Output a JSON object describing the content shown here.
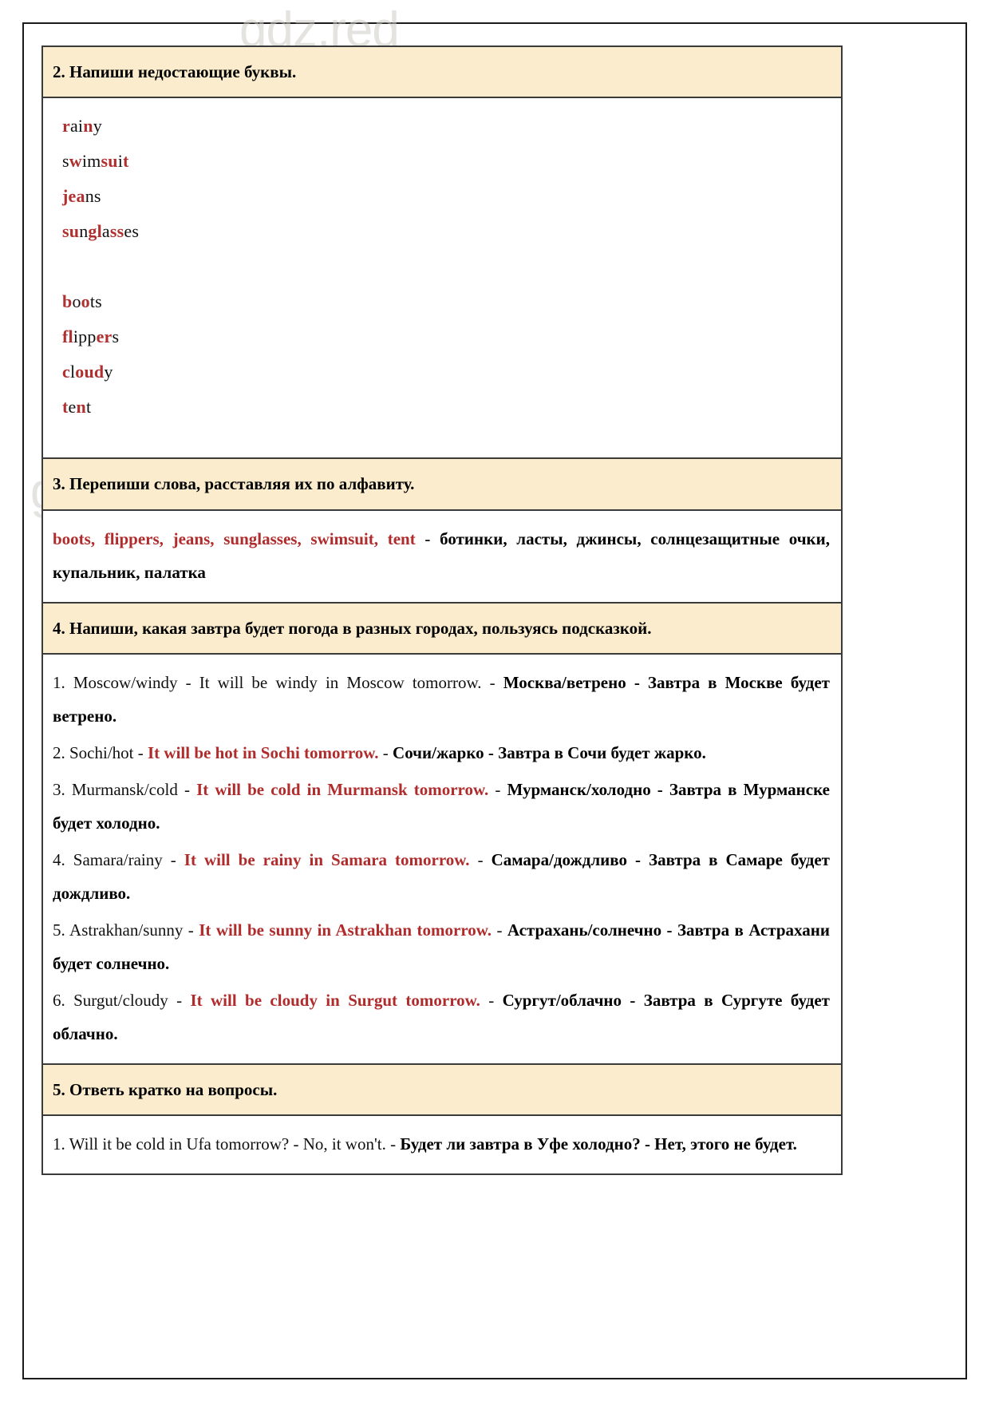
{
  "watermark": {
    "text": "gdz.red"
  },
  "tasks": [
    {
      "id": "task-2",
      "heading": "2. Напиши недостающие буквы.",
      "words": [
        {
          "word": "rainy",
          "parts": [
            [
              "r",
              "red"
            ],
            [
              "ai",
              "black"
            ],
            [
              "n",
              "red"
            ],
            [
              "y",
              "black"
            ]
          ]
        },
        {
          "word": "swimsuit",
          "parts": [
            [
              "s",
              "black"
            ],
            [
              "w",
              "red"
            ],
            [
              "im",
              "black"
            ],
            [
              "su",
              "red"
            ],
            [
              "i",
              "black"
            ],
            [
              "t",
              "red"
            ]
          ]
        },
        {
          "word": "jeans",
          "parts": [
            [
              "je",
              "red"
            ],
            [
              "a",
              "red"
            ],
            [
              "ns",
              "black"
            ]
          ]
        },
        {
          "word": "sunglasses",
          "parts": [
            [
              "su",
              "red"
            ],
            [
              "n",
              "black"
            ],
            [
              "gl",
              "red"
            ],
            [
              "a",
              "black"
            ],
            [
              "ss",
              "red"
            ],
            [
              "es",
              "black"
            ]
          ]
        },
        {
          "word": "",
          "parts": []
        },
        {
          "word": "boots",
          "parts": [
            [
              "b",
              "red"
            ],
            [
              "o",
              "black"
            ],
            [
              "o",
              "red"
            ],
            [
              "ts",
              "black"
            ]
          ]
        },
        {
          "word": "flippers",
          "parts": [
            [
              "fl",
              "red"
            ],
            [
              "ipp",
              "black"
            ],
            [
              "er",
              "red"
            ],
            [
              "s",
              "black"
            ]
          ]
        },
        {
          "word": "cloudy",
          "parts": [
            [
              "c",
              "red"
            ],
            [
              "l",
              "black"
            ],
            [
              "ou",
              "red"
            ],
            [
              "d",
              "red"
            ],
            [
              "y",
              "black"
            ]
          ]
        },
        {
          "word": "tent",
          "parts": [
            [
              "t",
              "red"
            ],
            [
              "e",
              "black"
            ],
            [
              "n",
              "red"
            ],
            [
              "t",
              "black"
            ]
          ]
        }
      ]
    },
    {
      "id": "task-3",
      "heading": "3. Перепиши слова, расставляя их по алфавиту.",
      "answer_en": "boots, flippers, jeans, sunglasses, swimsuit, tent",
      "answer_sep": " - ",
      "answer_ru": "ботинки, ласты, джинсы, солнцезащитные очки, купальник, палатка"
    },
    {
      "id": "task-4",
      "heading": "4. Напиши, какая завтра будет погода в разных городах, пользуясь подсказкой.",
      "items": [
        {
          "num": "1.",
          "prompt": "Moscow/windy",
          "answer_en": "It will be windy in Moscow tomorrow.",
          "answer_en_color": "black",
          "answer_ru": "Москва/ветрено - Завтра в Москве будет ветрено."
        },
        {
          "num": "2.",
          "prompt": "Sochi/hot",
          "answer_en": "It will be hot in Sochi tomorrow.",
          "answer_en_color": "red",
          "answer_ru": "Сочи/жарко - Завтра в Сочи будет жарко."
        },
        {
          "num": "3.",
          "prompt": "Murmansk/cold",
          "answer_en": "It will be cold in Murmansk tomorrow.",
          "answer_en_color": "red",
          "answer_ru": "Мурманск/холодно - Завтра в Мурманске будет холодно."
        },
        {
          "num": "4.",
          "prompt": "Samara/rainy",
          "answer_en": "It will be rainy in Samara tomorrow.",
          "answer_en_color": "red",
          "answer_ru": "Самара/дождливо - Завтра в Самаре будет дождливо."
        },
        {
          "num": "5.",
          "prompt": "Astrakhan/sunny",
          "answer_en": "It will be sunny in Astrakhan tomorrow.",
          "answer_en_color": "red",
          "answer_ru": "Астрахань/солнечно - Завтра в Астрахани будет солнечно."
        },
        {
          "num": "6.",
          "prompt": "Surgut/cloudy",
          "answer_en": "It will be cloudy in Surgut tomorrow.",
          "answer_en_color": "red",
          "answer_ru": "Сургут/облачно - Завтра в Сургуте будет облачно."
        }
      ]
    },
    {
      "id": "task-5",
      "heading": "5. Ответь кратко на вопросы.",
      "items": [
        {
          "num": "1.",
          "prompt": "Will it be cold in Ufa tomorrow?",
          "answer_en": "No, it won't.",
          "answer_en_color": "black",
          "answer_ru": "Будет ли завтра в Уфе холодно? - Нет, этого не будет."
        }
      ]
    }
  ],
  "colors": {
    "header_bg": "#fbeccd",
    "accent_red": "#b02b2b",
    "border": "#3a3a3a",
    "text": "#111111"
  }
}
